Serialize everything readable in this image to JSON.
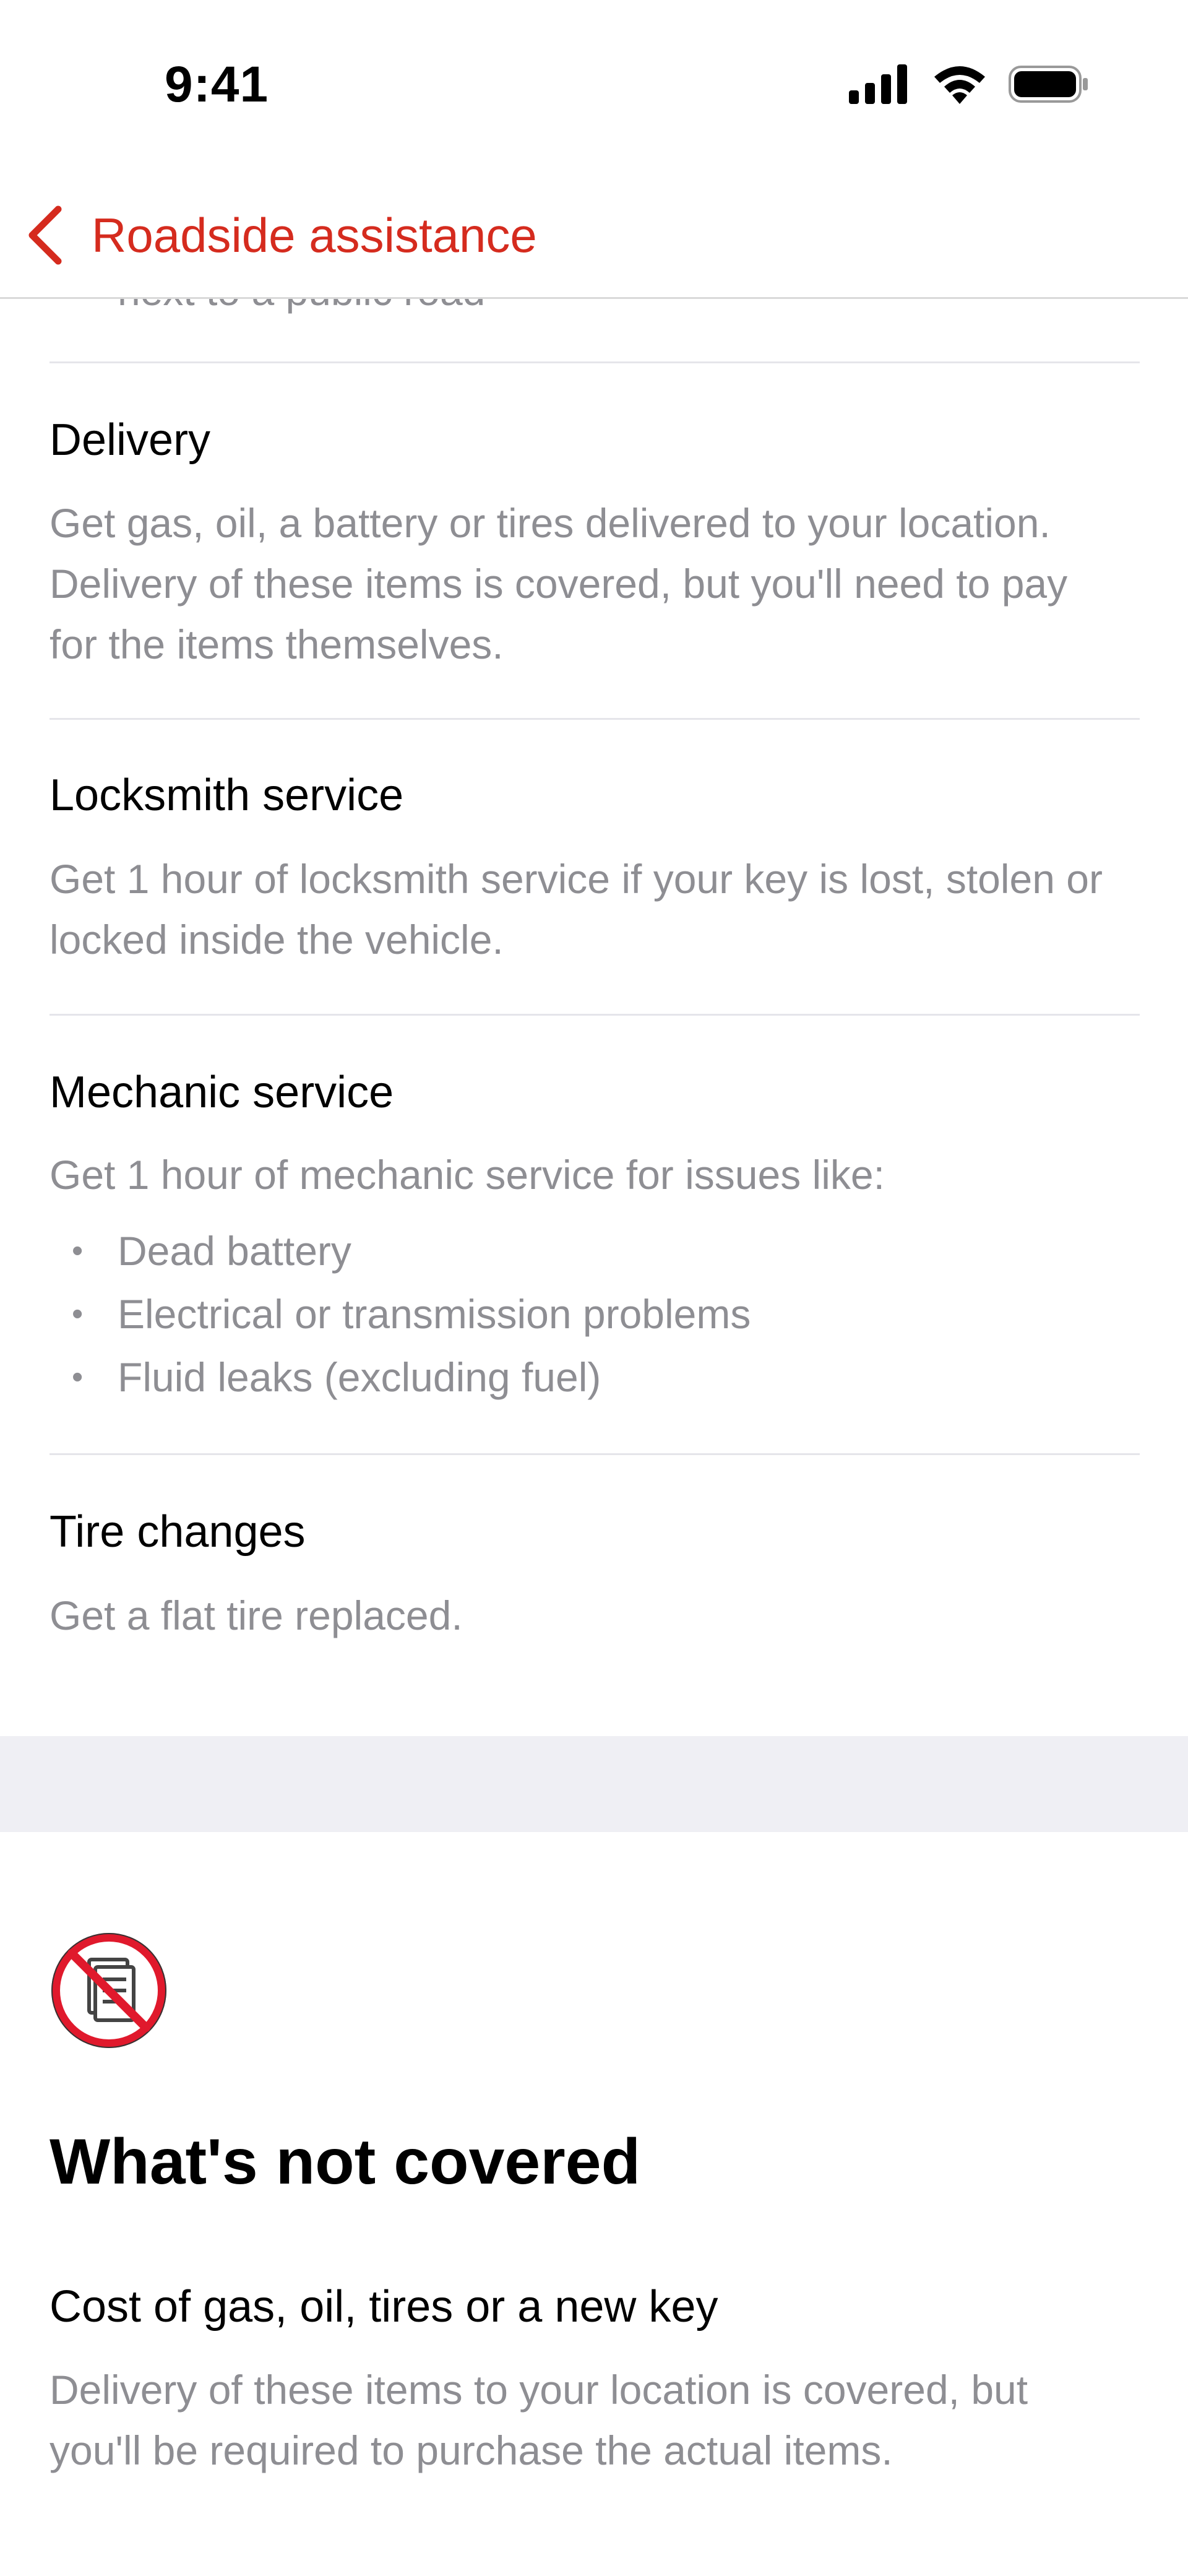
{
  "status_bar": {
    "time": "9:41",
    "icons": [
      "signal-icon",
      "wifi-icon",
      "battery-icon"
    ]
  },
  "nav": {
    "back_label": "Roadside assistance",
    "accent_color": "#d52b1e"
  },
  "clipped_text": "next to a public road",
  "sections": {
    "delivery": {
      "title": "Delivery",
      "desc": "Get gas, oil, a battery or tires delivered to your location. Delivery of these items is covered, but you'll need to pay for the items themselves."
    },
    "locksmith": {
      "title": "Locksmith service",
      "desc": "Get 1 hour of locksmith service if your key is lost, stolen or locked inside the vehicle."
    },
    "mechanic": {
      "title": "Mechanic service",
      "desc": "Get 1 hour of mechanic service for issues like:",
      "bullets": [
        "Dead battery",
        "Electrical or transmission problems",
        "Fluid leaks (excluding fuel)"
      ]
    },
    "tire": {
      "title": "Tire changes",
      "desc": "Get a flat tire replaced."
    }
  },
  "not_covered": {
    "icon": "prohibited-document-icon",
    "title": "What's not covered",
    "item_title": "Cost of gas, oil, tires or a new key",
    "item_desc": "Delivery of these items to your location is covered, but you'll be required to purchase the actual items."
  }
}
